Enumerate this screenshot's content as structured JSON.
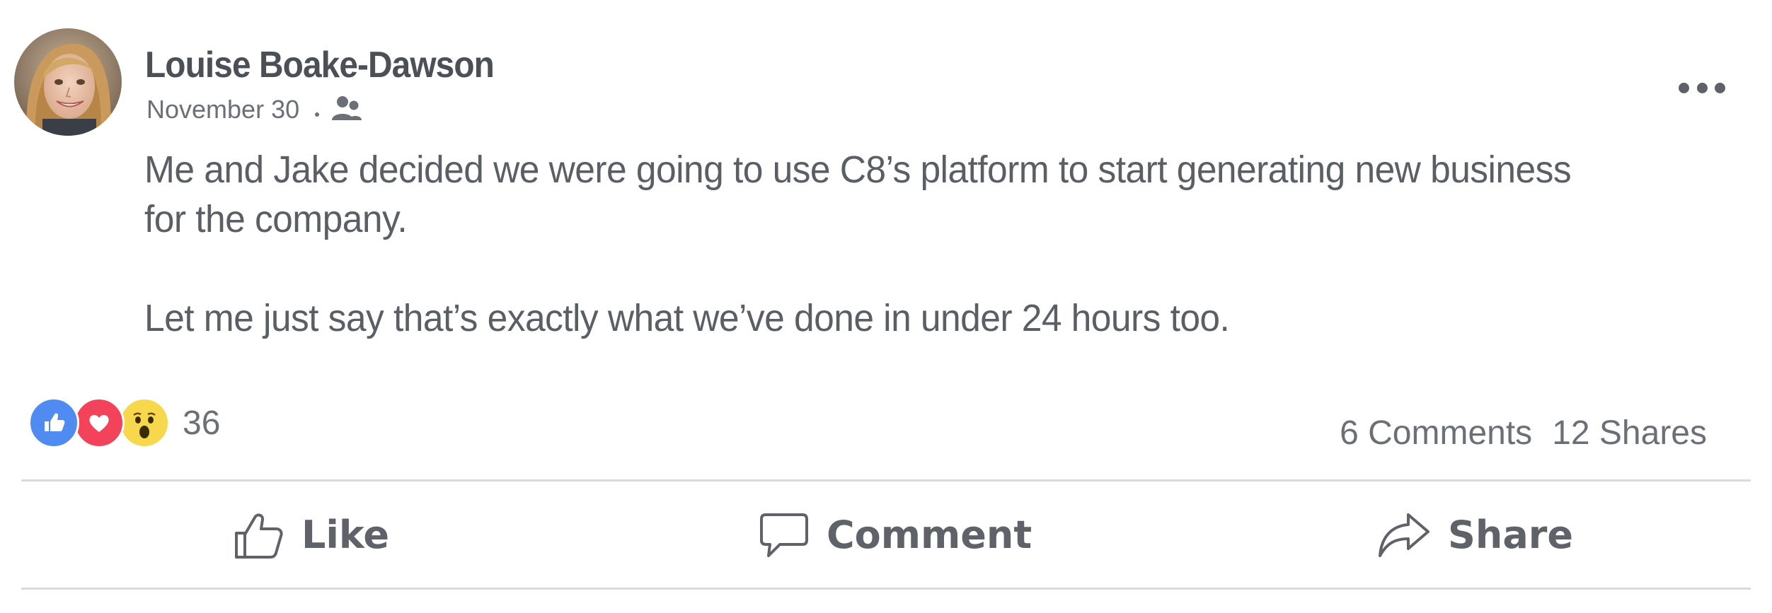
{
  "post": {
    "author": "Louise Boake-Dawson",
    "date": "November 30",
    "audience_icon": "friends-icon",
    "more_icon": "more-options-icon",
    "body": {
      "paragraph_1_line_1": "Me and Jake decided we were going to use C8’s platform to start generating new business",
      "paragraph_1_line_2": "for the company.",
      "paragraph_2": "Let me just say that’s exactly what we’ve done in under 24 hours too."
    },
    "reactions": {
      "icons": [
        "like-reaction-icon",
        "love-reaction-icon",
        "wow-reaction-icon"
      ],
      "count": "36"
    },
    "stats": {
      "comments": "6 Comments",
      "shares": "12 Shares"
    },
    "actions": {
      "like_label": "Like",
      "comment_label": "Comment",
      "share_label": "Share"
    },
    "colors": {
      "like_blue": "#4f8bf1",
      "love_red": "#f2435b",
      "wow_yellow": "#f7d74b",
      "text_gray": "#5a5e65"
    }
  }
}
